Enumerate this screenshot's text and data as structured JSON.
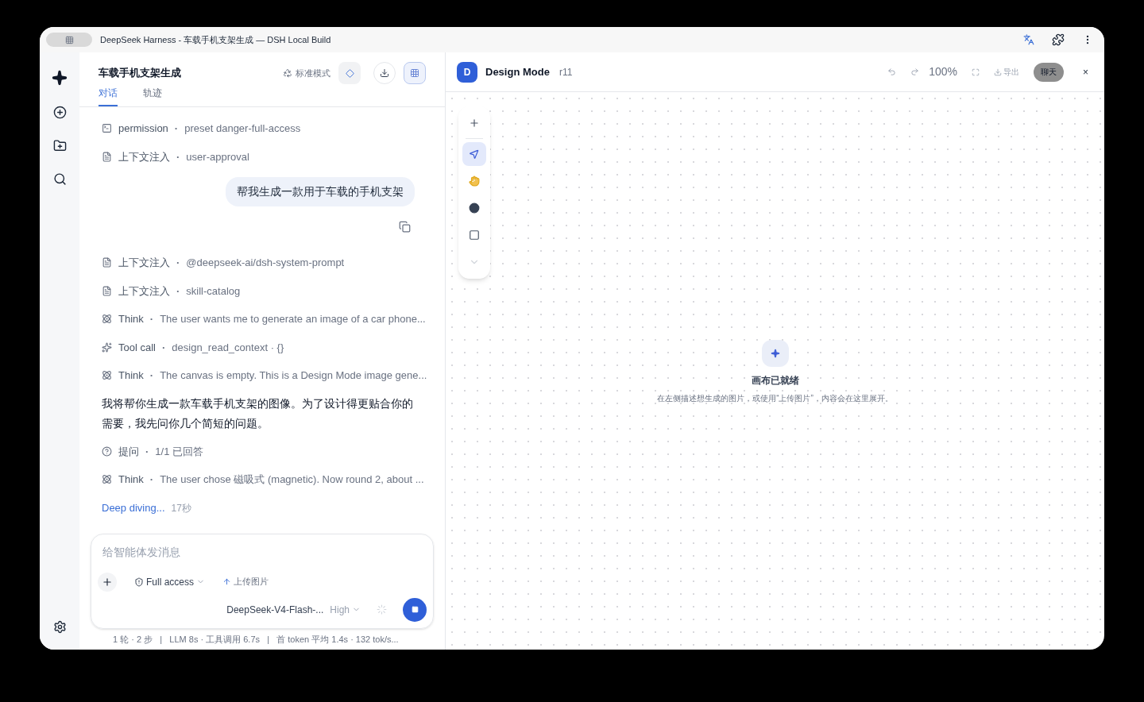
{
  "window": {
    "title": "DeepSeek Harness - 车载手机支架生成 — DSH Local Build"
  },
  "chat": {
    "title": "车载手机支架生成",
    "mode": "标准模式",
    "tabs": [
      {
        "label": "对话",
        "selected": true
      },
      {
        "label": "轨迹",
        "selected": false
      }
    ],
    "items": [
      {
        "kind": "terminal",
        "label": "permission",
        "separator": "·",
        "detail": "preset danger-full-access"
      },
      {
        "kind": "context",
        "label": "上下文注入",
        "separator": "·",
        "detail": "user-approval"
      },
      {
        "kind": "user",
        "text": "帮我生成一款用于车载的手机支架"
      },
      {
        "kind": "context",
        "label": "上下文注入",
        "separator": "·",
        "detail": "@deepseek-ai/dsh-system-prompt"
      },
      {
        "kind": "context",
        "label": "上下文注入",
        "separator": "·",
        "detail": "skill-catalog"
      },
      {
        "kind": "think",
        "label": "Think",
        "separator": "·",
        "detail": "The user wants me to generate an image of a car phone..."
      },
      {
        "kind": "tool",
        "label": "Tool call",
        "separator": "·",
        "detail": "design_read_context · {}"
      },
      {
        "kind": "think",
        "label": "Think",
        "separator": "·",
        "detail": "The canvas is empty. This is a Design Mode image gene..."
      },
      {
        "kind": "assistant",
        "text": "我将帮你生成一款车载手机支架的图像。为了设计得更贴合你的需要，我先问你几个简短的问题。"
      },
      {
        "kind": "question",
        "label": "提问",
        "separator": "·",
        "detail": "1/1 已回答"
      },
      {
        "kind": "think",
        "label": "Think",
        "separator": "·",
        "detail": "The user chose 磁吸式 (magnetic). Now round 2, about ..."
      },
      {
        "kind": "status",
        "text": "Deep diving...",
        "time": "17秒"
      }
    ],
    "composer": {
      "placeholder": "给智能体发消息",
      "access": "Full access",
      "upload": "上传图片",
      "model": "DeepSeek-V4-Flash-...",
      "effort": "High"
    },
    "stats": "1 轮 · 2 步   |   LLM 8s · 工具调用 6.7s   |   首 token 平均 1.4s · 132 tok/s..."
  },
  "canvas": {
    "avatar": "D",
    "title": "Design Mode",
    "revision": "r11",
    "zoom": "100%",
    "export": {
      "label": "导出",
      "disabled": true
    },
    "chat_button": "聊天",
    "close": "×",
    "tools": [
      {
        "kind": "add",
        "selected": false
      },
      {
        "kind": "select",
        "selected": true
      },
      {
        "kind": "hand",
        "selected": false
      },
      {
        "kind": "dot",
        "selected": false
      },
      {
        "kind": "rect",
        "selected": false
      },
      {
        "kind": "more",
        "selected": false
      }
    ],
    "empty_title": "画布已就绪",
    "empty_hint": "在左侧描述想生成的图片，或使用“上传图片”，内容会在这里展开。"
  }
}
